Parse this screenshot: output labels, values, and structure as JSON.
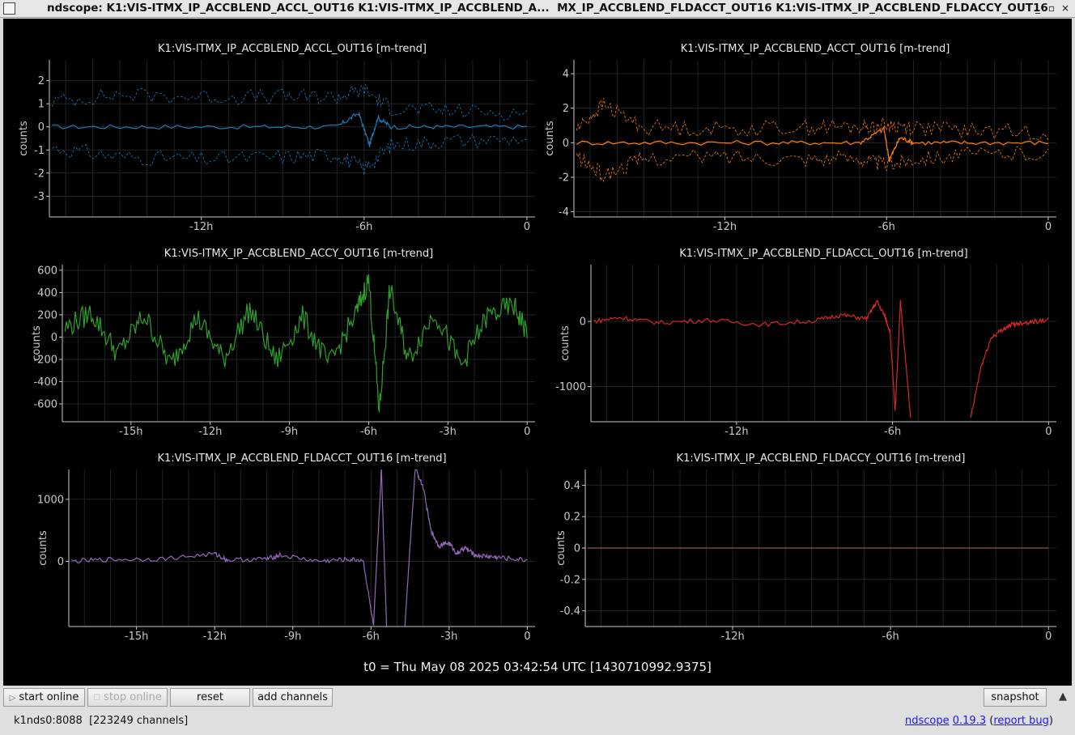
{
  "window": {
    "title": "ndscope: K1:VIS-ITMX_IP_ACCBLEND_ACCL_OUT16 K1:VIS-ITMX_IP_ACCBLEND_A...  MX_IP_ACCBLEND_FLDACCT_OUT16 K1:VIS-ITMX_IP_ACCBLEND_FLDACCY_OUT16",
    "minimize_glyph": "_",
    "maximize_glyph": "▫",
    "close_glyph": "×"
  },
  "t0_label": "t0 = Thu May 08 2025 03:42:54 UTC [1430710992.9375]",
  "toolbar": {
    "start_online": "start online",
    "start_icon": "▷",
    "stop_online": "stop online",
    "stop_icon": "☐",
    "reset": "reset",
    "add_channels": "add channels",
    "snapshot": "snapshot",
    "collapse_glyph": "▲"
  },
  "status": {
    "server": "k1nds0:8088",
    "channels": "[223249 channels]"
  },
  "about": {
    "app": "ndscope",
    "version": "0.19.3",
    "open_paren": "(",
    "report": "report bug",
    "close_paren": ")"
  },
  "colors": {
    "background": "#000000",
    "axis": "#c8c8c8",
    "grid": "#222222"
  },
  "chart_data": [
    {
      "type": "line",
      "title": "K1:VIS-ITMX_IP_ACCBLEND_ACCL_OUT16 [m-trend]",
      "ylabel": "counts",
      "color": "#1f77b4",
      "xlim": [
        -17.6,
        0.3
      ],
      "ylim": [
        -3.9,
        2.9
      ],
      "xticks": [
        -12,
        -6,
        0
      ],
      "xtick_labels": [
        "-12h",
        "-6h",
        "0"
      ],
      "yticks": [
        2,
        1,
        0,
        -1,
        -2,
        -3
      ],
      "ytick_labels": [
        "2",
        "1",
        "0",
        "-1",
        "-2",
        "-3"
      ],
      "series": [
        {
          "style": "mean",
          "x": [
            -17.5,
            -14,
            -10,
            -7,
            -6.2,
            -5.8,
            -5.5,
            -5,
            -3,
            0
          ],
          "y": [
            0,
            0,
            0,
            0,
            0.6,
            -0.8,
            0.4,
            0,
            0,
            0
          ]
        },
        {
          "style": "max",
          "x": [
            -17.5,
            -15,
            -12,
            -9,
            -7,
            -6,
            -5,
            -3,
            0
          ],
          "y": [
            1.1,
            1.4,
            1.3,
            1.3,
            1.3,
            1.6,
            0.8,
            0.7,
            0.6
          ]
        },
        {
          "style": "min",
          "x": [
            -17.5,
            -15,
            -12,
            -9,
            -7,
            -6,
            -5,
            -3,
            0
          ],
          "y": [
            -0.9,
            -1.3,
            -1.4,
            -1.3,
            -1.2,
            -1.8,
            -0.8,
            -0.6,
            -0.5
          ]
        }
      ]
    },
    {
      "type": "line",
      "title": "K1:VIS-ITMX_IP_ACCBLEND_ACCT_OUT16 [m-trend]",
      "ylabel": "counts",
      "color": "#ff7f0e",
      "xlim": [
        -17.6,
        0.3
      ],
      "ylim": [
        -4.3,
        4.8
      ],
      "xticks": [
        -12,
        -6,
        0
      ],
      "xtick_labels": [
        "-12h",
        "-6h",
        "0"
      ],
      "yticks": [
        4,
        2,
        0,
        -2,
        -4
      ],
      "ytick_labels": [
        "4",
        "2",
        "0",
        "-2",
        "-4"
      ],
      "series": [
        {
          "style": "mean",
          "x": [
            -17.5,
            -14,
            -10,
            -7,
            -6.1,
            -5.9,
            -5.5,
            -5,
            -3,
            0
          ],
          "y": [
            0,
            0,
            0,
            0,
            0.8,
            -1.0,
            0.3,
            0,
            0,
            0
          ]
        },
        {
          "style": "max",
          "x": [
            -17.5,
            -16.5,
            -15,
            -12,
            -9,
            -7,
            -6,
            -5,
            -3,
            0
          ],
          "y": [
            0.8,
            2.2,
            0.9,
            0.8,
            0.9,
            0.9,
            1.0,
            0.9,
            0.7,
            0.6
          ]
        },
        {
          "style": "min",
          "x": [
            -17.5,
            -16.5,
            -15,
            -12,
            -9,
            -7,
            -6,
            -5,
            -3,
            0
          ],
          "y": [
            -0.8,
            -1.9,
            -0.9,
            -0.8,
            -0.9,
            -0.9,
            -1.3,
            -0.9,
            -0.7,
            -0.6
          ]
        }
      ]
    },
    {
      "type": "line",
      "title": "K1:VIS-ITMX_IP_ACCBLEND_ACCY_OUT16 [m-trend]",
      "ylabel": "counts",
      "color": "#2ca02c",
      "xlim": [
        -17.6,
        0.3
      ],
      "ylim": [
        -760,
        650
      ],
      "xticks": [
        -15,
        -12,
        -9,
        -6,
        -3,
        0
      ],
      "xtick_labels": [
        "-15h",
        "-12h",
        "-9h",
        "-6h",
        "-3h",
        "0"
      ],
      "yticks": [
        600,
        400,
        200,
        0,
        -200,
        -400,
        -600
      ],
      "ytick_labels": [
        "600",
        "400",
        "200",
        "0",
        "-200",
        "-400",
        "-600"
      ],
      "series": [
        {
          "x": [
            -17.5,
            -16.5,
            -15.5,
            -14.5,
            -13.5,
            -12.5,
            -11.5,
            -10.5,
            -9.5,
            -8.5,
            -7.5,
            -6.5,
            -6.0,
            -5.6,
            -5.2,
            -4.5,
            -3.5,
            -2.5,
            -1.5,
            -0.5,
            0
          ],
          "y": [
            80,
            220,
            -150,
            200,
            -250,
            180,
            -200,
            250,
            -220,
            180,
            -250,
            200,
            520,
            -660,
            430,
            -200,
            230,
            -260,
            190,
            280,
            40
          ]
        }
      ]
    },
    {
      "type": "line",
      "title": "K1:VIS-ITMX_IP_ACCBLEND_FLDACCL_OUT16 [m-trend]",
      "ylabel": "counts",
      "color": "#d62728",
      "xlim": [
        -17.6,
        0.3
      ],
      "ylim": [
        -1540,
        870
      ],
      "xticks": [
        -12,
        -6,
        0
      ],
      "xtick_labels": [
        "-12h",
        "-6h",
        "0"
      ],
      "yticks": [
        0,
        -1000
      ],
      "ytick_labels": [
        "0",
        "-1000"
      ],
      "series": [
        {
          "x": [
            -17.5,
            -16.5,
            -15,
            -13,
            -11,
            -9,
            -8,
            -7,
            -6.6,
            -6.3,
            -6.1,
            -5.9,
            -5.7,
            -5.3
          ],
          "y": [
            0,
            60,
            -20,
            20,
            -50,
            10,
            100,
            40,
            310,
            80,
            -150,
            -1400,
            300,
            -1500
          ]
        },
        {
          "x": [
            -3,
            -2.6,
            -2.2,
            -1.8,
            -1.4,
            -1,
            -0.5,
            0
          ],
          "y": [
            -1500,
            -700,
            -250,
            -130,
            -50,
            -20,
            0,
            20
          ]
        }
      ]
    },
    {
      "type": "line",
      "title": "K1:VIS-ITMX_IP_ACCBLEND_FLDACCT_OUT16 [m-trend]",
      "ylabel": "counts",
      "color": "#9467bd",
      "xlim": [
        -17.6,
        0.3
      ],
      "ylim": [
        -1050,
        1480
      ],
      "xticks": [
        -15,
        -12,
        -9,
        -6,
        -3,
        0
      ],
      "xtick_labels": [
        "-15h",
        "-12h",
        "-9h",
        "-6h",
        "-3h",
        "0"
      ],
      "yticks": [
        1000,
        0
      ],
      "ytick_labels": [
        "1000",
        "0"
      ],
      "series": [
        {
          "x": [
            -17.5,
            -16,
            -14,
            -12,
            -11.5,
            -10,
            -9.5,
            -8,
            -7,
            -6.3,
            -5.9,
            -5.6,
            -5.4
          ],
          "y": [
            0,
            30,
            40,
            120,
            20,
            40,
            100,
            0,
            30,
            20,
            -1050,
            1480,
            -1050
          ]
        },
        {
          "x": [
            -4.7,
            -4.3,
            -4.0,
            -3.7,
            -3.4,
            -3.0,
            -2.7,
            -2.4,
            -2,
            -1.5,
            -1,
            0
          ],
          "y": [
            -1050,
            1500,
            1200,
            500,
            250,
            300,
            120,
            220,
            100,
            80,
            60,
            20
          ]
        }
      ]
    },
    {
      "type": "line",
      "title": "K1:VIS-ITMX_IP_ACCBLEND_FLDACCY_OUT16 [m-trend]",
      "ylabel": "counts",
      "color": "#8c564b",
      "xlim": [
        -17.6,
        0.3
      ],
      "ylim": [
        -0.5,
        0.5
      ],
      "xticks": [
        -12,
        -6,
        0
      ],
      "xtick_labels": [
        "-12h",
        "-6h",
        "0"
      ],
      "yticks": [
        0.4,
        0.2,
        0,
        -0.2,
        -0.4
      ],
      "ytick_labels": [
        "0.4",
        "0.2",
        "0",
        "-0.2",
        "-0.4"
      ],
      "series": [
        {
          "x": [
            -17.5,
            0
          ],
          "y": [
            0,
            0
          ]
        }
      ]
    }
  ]
}
